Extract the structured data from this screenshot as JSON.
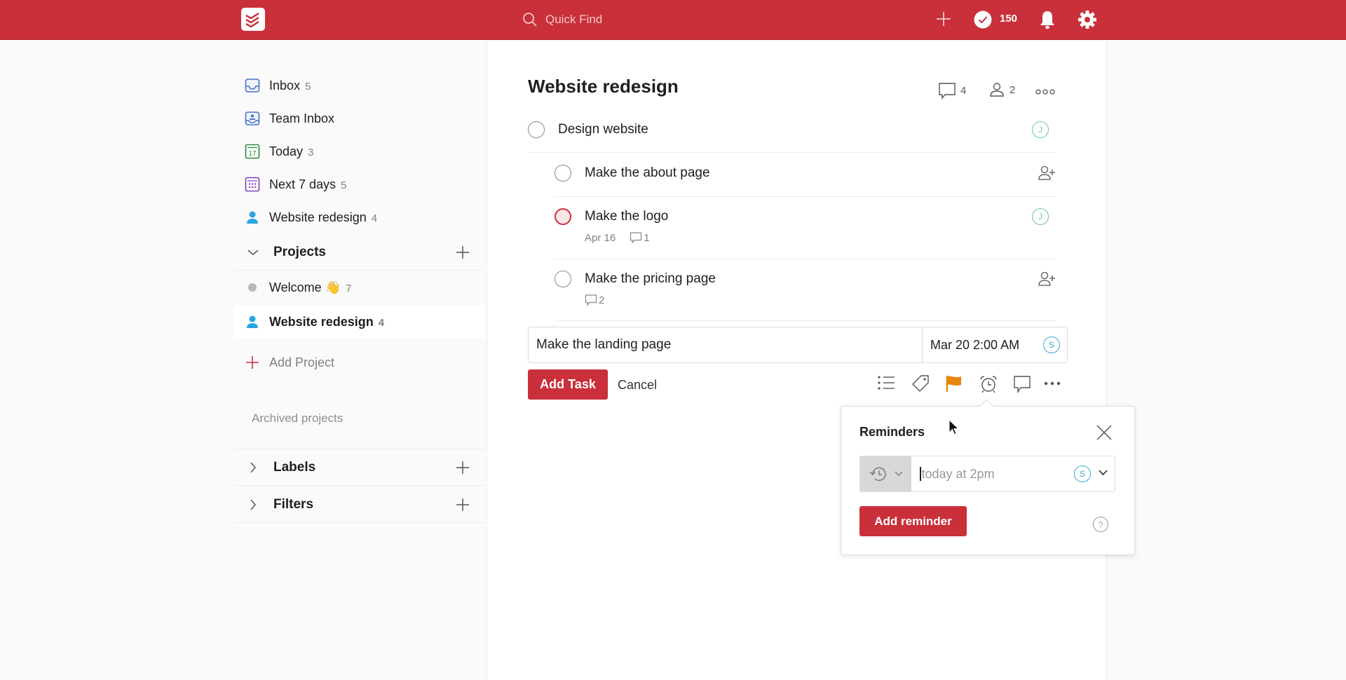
{
  "topbar": {
    "logo": "todoist-logo-icon",
    "search_placeholder": "Quick Find",
    "karma_count": "150",
    "icons": [
      "search-icon",
      "plus-icon",
      "karma-check-icon",
      "bell-icon",
      "gear-icon"
    ],
    "brand_color": "#c9303a"
  },
  "sidebar": {
    "nav": [
      {
        "label": "Inbox",
        "count": "5",
        "icon": "inbox-icon"
      },
      {
        "label": "Team Inbox",
        "count": "",
        "icon": "team-inbox-icon"
      },
      {
        "label": "Today",
        "count": "3",
        "icon": "calendar-today-icon",
        "icon_text": "17"
      },
      {
        "label": "Next 7 days",
        "count": "5",
        "icon": "calendar-week-icon"
      },
      {
        "label": "Website redesign",
        "count": "4",
        "icon": "person-icon"
      }
    ],
    "projects_header": "Projects",
    "projects": [
      {
        "label": "Welcome 👋",
        "count": "7",
        "icon": "gray-dot-icon"
      },
      {
        "label": "Website redesign",
        "count": "4",
        "icon": "person-icon",
        "active": true
      }
    ],
    "add_project": "Add Project",
    "archived": "Archived projects",
    "labels_header": "Labels",
    "filters_header": "Filters"
  },
  "main": {
    "title": "Website redesign",
    "comments_count": "4",
    "members_count": "2",
    "tasks": [
      {
        "title": "Design website",
        "assignee": "J",
        "level": 0
      },
      {
        "title": "Make the about page",
        "assignee": "",
        "level": 1
      },
      {
        "title": "Make the logo",
        "assignee": "J",
        "level": 1,
        "priority": "p1",
        "due": "Apr 16",
        "comments": "1"
      },
      {
        "title": "Make the pricing page",
        "assignee": "",
        "level": 1,
        "comments": "2"
      }
    ],
    "editor": {
      "task_text": "Make the landing page",
      "due_text": "Mar 20 2:00 AM",
      "assignee": "S",
      "add_label": "Add Task",
      "cancel_label": "Cancel",
      "toolbar_icons": [
        "project-list-icon",
        "label-tag-icon",
        "priority-flag-icon",
        "reminder-alarm-icon",
        "comment-icon",
        "more-icon"
      ],
      "flag_color": "#e8850c"
    }
  },
  "reminders": {
    "title": "Reminders",
    "input_placeholder": "today at 2pm",
    "assignee": "S",
    "add_label": "Add reminder"
  }
}
